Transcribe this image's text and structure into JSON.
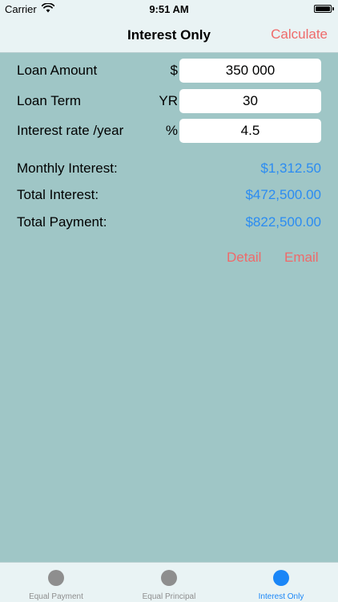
{
  "status_bar": {
    "carrier": "Carrier",
    "time": "9:51 AM"
  },
  "nav": {
    "title": "Interest Only",
    "action_label": "Calculate"
  },
  "form": {
    "loan_amount": {
      "label": "Loan Amount",
      "unit": "$",
      "value": "350 000"
    },
    "loan_term": {
      "label": "Loan Term",
      "unit": "YR",
      "value": "30"
    },
    "interest_rate": {
      "label": "Interest rate /year",
      "unit": "%",
      "value": "4.5"
    }
  },
  "results": {
    "monthly_interest": {
      "label": "Monthly Interest:",
      "value": "$1,312.50"
    },
    "total_interest": {
      "label": "Total Interest:",
      "value": "$472,500.00"
    },
    "total_payment": {
      "label": "Total Payment:",
      "value": "$822,500.00"
    }
  },
  "actions": {
    "detail_label": "Detail",
    "email_label": "Email"
  },
  "tabbar": {
    "tabs": [
      {
        "label": "Equal Payment",
        "active": false
      },
      {
        "label": "Equal Principal",
        "active": false
      },
      {
        "label": "Interest Only",
        "active": true
      }
    ]
  },
  "colors": {
    "background": "#9fc6c6",
    "bar_background": "#e9f3f4",
    "accent_red": "#ef6a6a",
    "value_blue": "#2b8cf2",
    "tab_active": "#1a86f7",
    "tab_inactive": "#8e8e8e"
  }
}
